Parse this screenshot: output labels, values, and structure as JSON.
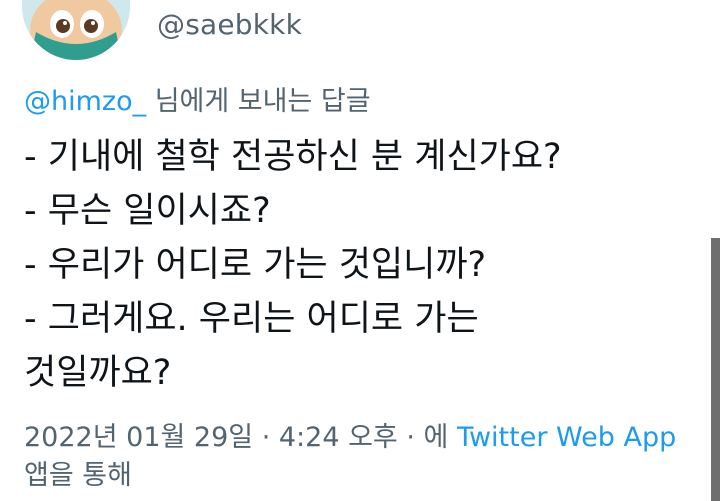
{
  "author": {
    "handle": "@saebkkk",
    "avatar_icon": "cartoon-boy-avatar"
  },
  "reply": {
    "mention": "@himzo_",
    "suffix": " 님에게 보내는 답글"
  },
  "tweet": {
    "lines": [
      "- 기내에 철학 전공하신 분 계신가요?",
      "- 무슨 일이시죠?",
      "- 우리가 어디로 가는 것입니까?",
      "- 그러게요. 우리는 어디로 가는",
      "것일까요?"
    ]
  },
  "meta": {
    "date": "2022년 01월 29일",
    "sep1": " · ",
    "time": "4:24 오후",
    "sep2": " · 에 ",
    "source": "Twitter Web App",
    "suffix": "앱을 통해"
  },
  "colors": {
    "text": "#0f1419",
    "secondary": "#536471",
    "link": "#1d9bf0"
  }
}
